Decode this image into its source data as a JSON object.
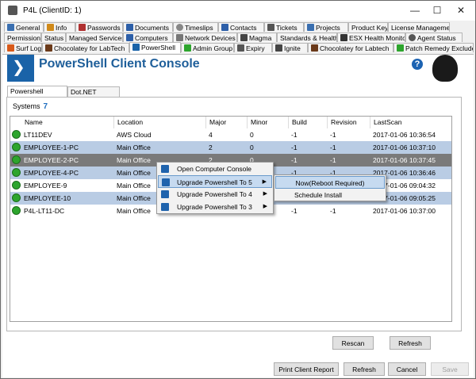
{
  "window": {
    "title": "P4L   (ClientID: 1)",
    "minimize": "—",
    "maximize": "☐",
    "close": "✕"
  },
  "tabs_row1": [
    {
      "label": "General",
      "color": "#3a6fb0"
    },
    {
      "label": "Info",
      "color": "#d08a1a"
    },
    {
      "label": "Passwords",
      "color": "#b03030"
    },
    {
      "label": "Documents",
      "color": "#2d5fa8"
    },
    {
      "label": "Timeslips",
      "color": "#888888"
    },
    {
      "label": "Contacts",
      "color": "#2d5fa8"
    },
    {
      "label": "Tickets",
      "color": "#555555"
    },
    {
      "label": "Projects",
      "color": "#3a6fb0"
    },
    {
      "label": "Product Keys",
      "color": ""
    },
    {
      "label": "License Management",
      "color": ""
    }
  ],
  "tabs_row2": [
    {
      "label": "Permissions"
    },
    {
      "label": "Status"
    },
    {
      "label": "Managed Services"
    },
    {
      "label": "Computers"
    },
    {
      "label": "Network Devices"
    },
    {
      "label": "Magma"
    },
    {
      "label": "Standards & Health"
    },
    {
      "label": "ESX Health Monitor"
    },
    {
      "label": "Agent Status"
    }
  ],
  "tabs_row3": [
    {
      "label": "Surf Log"
    },
    {
      "label": "Chocolatey for LabTech"
    },
    {
      "label": "PowerShell"
    },
    {
      "label": "Admin Group"
    },
    {
      "label": "Expiry"
    },
    {
      "label": "Ignite"
    },
    {
      "label": "Chocolatey for Labtech"
    },
    {
      "label": "Patch Remedy Excludes"
    }
  ],
  "header": {
    "title": "PowerShell Client Console",
    "logo_glyph": "❯",
    "help_glyph": "?"
  },
  "subtabs": [
    {
      "label": "Powershell Versions"
    },
    {
      "label": "Dot.NET Versions"
    }
  ],
  "systems": {
    "label": "Systems",
    "count": "7"
  },
  "columns": [
    "Name",
    "Location",
    "Major",
    "Minor",
    "Build",
    "Revision",
    "LastScan"
  ],
  "rows": [
    {
      "name": "LT11DEV",
      "location": "AWS Cloud",
      "major": "4",
      "minor": "0",
      "build": "-1",
      "revision": "-1",
      "lastscan": "2017-01-06 10:36:54"
    },
    {
      "name": "EMPLOYEE-1-PC",
      "location": "Main Office",
      "major": "2",
      "minor": "0",
      "build": "-1",
      "revision": "-1",
      "lastscan": "2017-01-06 10:37:10"
    },
    {
      "name": "EMPLOYEE-2-PC",
      "location": "Main Office",
      "major": "2",
      "minor": "0",
      "build": "-1",
      "revision": "-1",
      "lastscan": "2017-01-06 10:37:45"
    },
    {
      "name": "EMPLOYEE-4-PC",
      "location": "Main Office",
      "major": "2",
      "minor": "0",
      "build": "-1",
      "revision": "-1",
      "lastscan": "2017-01-06 10:36:46"
    },
    {
      "name": "EMPLOYEE-9",
      "location": "Main Office",
      "major": "",
      "minor": "",
      "build": "-1",
      "revision": "-1",
      "lastscan": "2017-01-06 09:04:32"
    },
    {
      "name": "EMPLOYEE-10",
      "location": "Main Office",
      "major": "",
      "minor": "",
      "build": "-1",
      "revision": "-1",
      "lastscan": "2017-01-06 09:05:25"
    },
    {
      "name": "P4L-LT11-DC",
      "location": "Main Office",
      "major": "",
      "minor": "",
      "build": "-1",
      "revision": "-1",
      "lastscan": "2017-01-06 10:37:00"
    }
  ],
  "context_menu": {
    "items": [
      {
        "label": "Open Computer Console",
        "submenu": false
      },
      {
        "label": "Upgrade Powershell To 5",
        "submenu": true
      },
      {
        "label": "Upgrade Powershell To 4",
        "submenu": true
      },
      {
        "label": "Upgrade Powershell To 3",
        "submenu": true
      }
    ],
    "submenu_arrow": "▶"
  },
  "submenu": {
    "items": [
      {
        "label": "Now(Reboot Required)"
      },
      {
        "label": "Schedule Install"
      }
    ]
  },
  "buttons": {
    "rescan": "Rescan",
    "refresh_grid": "Refresh",
    "print": "Print Client Report",
    "refresh": "Refresh",
    "cancel": "Cancel",
    "save": "Save"
  },
  "colors": {
    "selected_row": "#b9cce4",
    "dark_row": "#7a7a7a",
    "accent": "#1f5f9a"
  }
}
